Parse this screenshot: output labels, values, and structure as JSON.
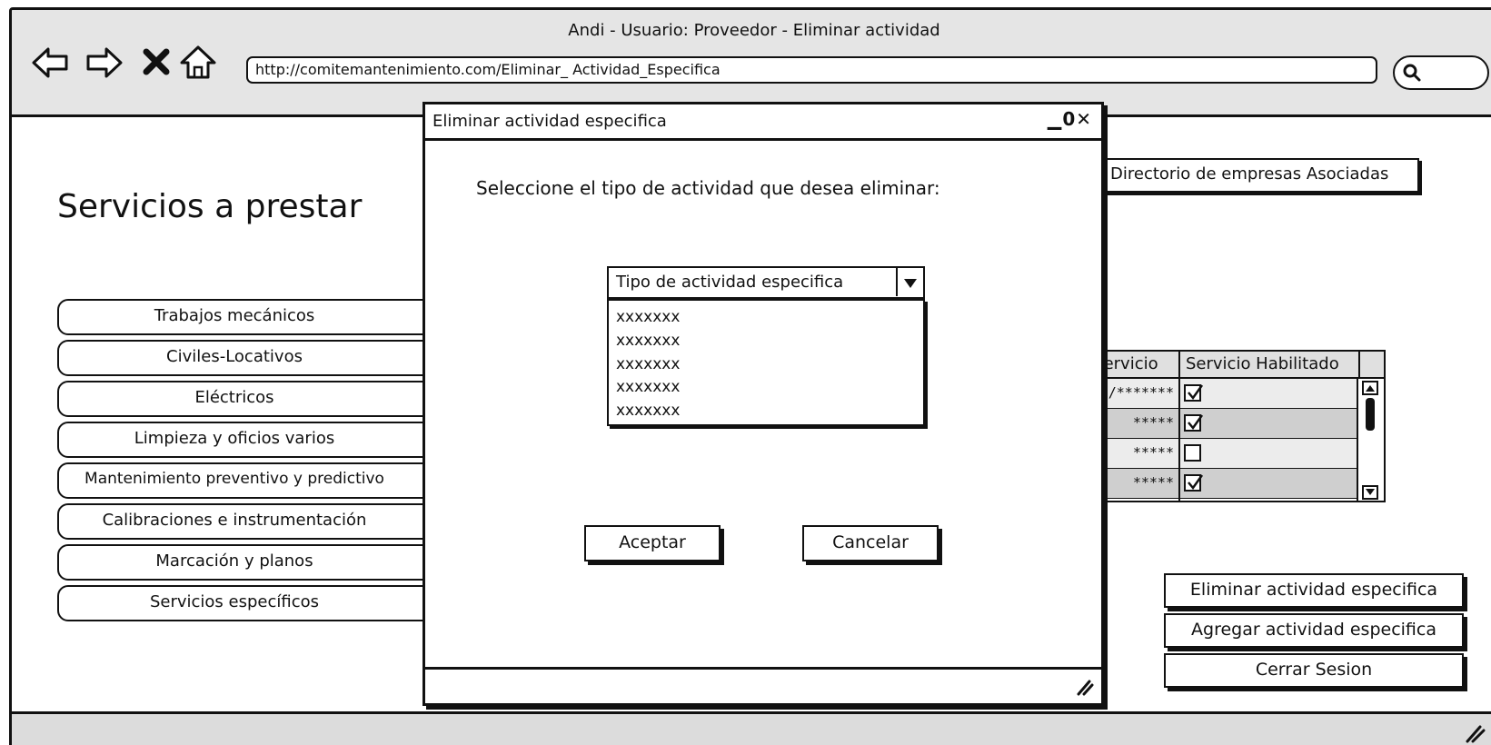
{
  "window": {
    "title": "Andi - Usuario: Proveedor - Eliminar actividad",
    "url": "http://comitemantenimiento.com/Eliminar_ Actividad_Especifica"
  },
  "page": {
    "title": "Servicios a prestar"
  },
  "menu": {
    "items": [
      {
        "label": "Trabajos mecánicos"
      },
      {
        "label": "Civiles-Locativos"
      },
      {
        "label": "Eléctricos"
      },
      {
        "label": "Limpieza y oficios varios"
      },
      {
        "label": "Mantenimiento preventivo y predictivo"
      },
      {
        "label": "Calibraciones e instrumentación"
      },
      {
        "label": "Marcación y planos"
      },
      {
        "label": "Servicios específicos"
      }
    ]
  },
  "directory_button": {
    "label": "Directorio de empresas Asociadas"
  },
  "table": {
    "columns": [
      "en servicio",
      "Servicio Habilitado"
    ],
    "rows": [
      {
        "value": "** /*******",
        "checked": true
      },
      {
        "value": "*****",
        "checked": true
      },
      {
        "value": "*****",
        "checked": false
      },
      {
        "value": "*****",
        "checked": true
      }
    ]
  },
  "actions": {
    "delete_label": "Eliminar actividad especifica",
    "add_label": "Agregar actividad especifica",
    "logout_label": "Cerrar Sesion"
  },
  "dialog": {
    "title": "Eliminar actividad especifica",
    "prompt": "Seleccione el tipo de actividad que desea eliminar:",
    "select": {
      "value": "Tipo de actividad especifica",
      "options": [
        "xxxxxxx",
        "xxxxxxx",
        "xxxxxxx",
        "xxxxxxx",
        "xxxxxxx"
      ]
    },
    "accept_label": "Aceptar",
    "cancel_label": "Cancelar"
  },
  "colors": {
    "chrome_bg": "#e5e5e5",
    "stroke": "#111111",
    "row_shade": "#cfcfcf",
    "row_light": "#ececec"
  },
  "icons": [
    "back-arrow-icon",
    "forward-arrow-icon",
    "stop-icon",
    "home-icon",
    "search-icon",
    "minimize-icon",
    "maximize-icon",
    "close-icon",
    "dropdown-arrow-icon",
    "scroll-up-icon",
    "scroll-down-icon",
    "resize-grip-icon"
  ]
}
